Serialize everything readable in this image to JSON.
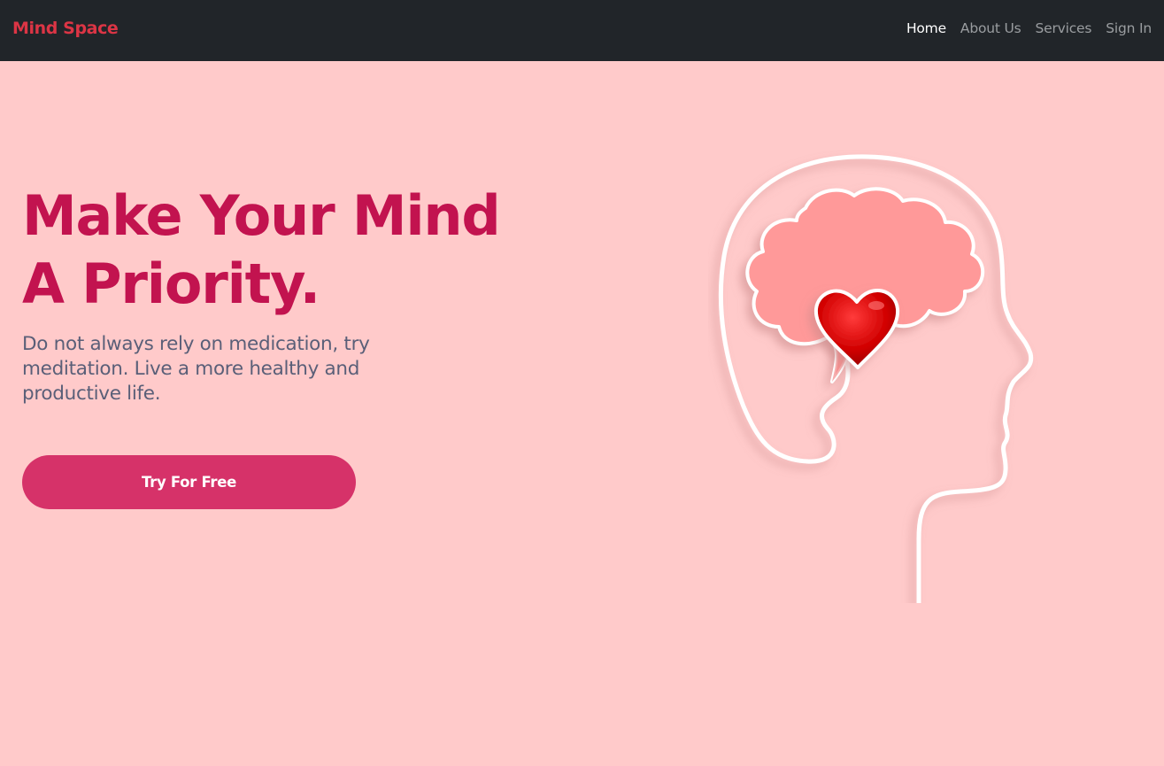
{
  "navbar": {
    "brand": "Mind Space",
    "links": [
      {
        "label": "Home",
        "active": true
      },
      {
        "label": "About Us",
        "active": false
      },
      {
        "label": "Services",
        "active": false
      },
      {
        "label": "Sign In",
        "active": false
      }
    ]
  },
  "hero": {
    "title_line1": "Make Your Mind",
    "title_line2": "A Priority.",
    "subtitle": "Do not always rely on medication, try meditation. Live a more healthy and productive life.",
    "cta_label": "Try For Free"
  },
  "colors": {
    "navbar_bg": "#212529",
    "brand": "#dc3545",
    "hero_bg": "#ffcaca",
    "title": "#c2134f",
    "subtitle": "#5a5f78",
    "cta_bg": "#d63269",
    "brain": "#ff9999",
    "heart": "#d10000"
  },
  "icons": {
    "illustration": "head-brain-heart-illustration"
  }
}
